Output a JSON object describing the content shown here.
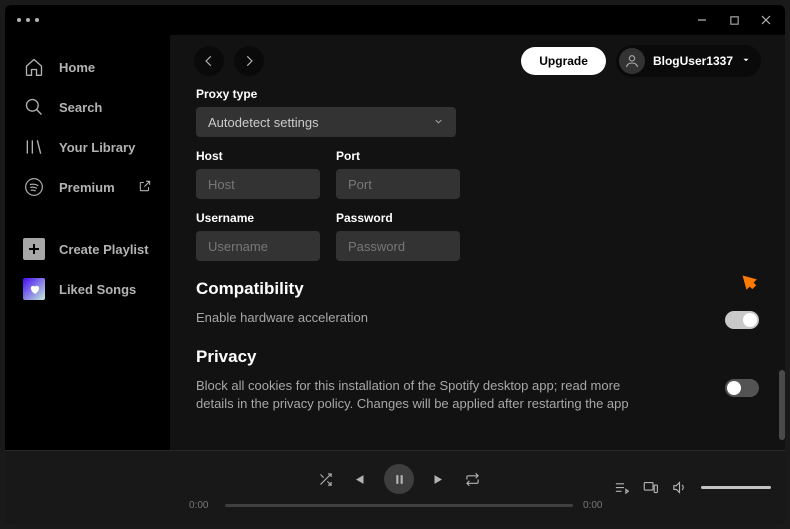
{
  "titlebar": {
    "minimize": "min",
    "maximize": "max",
    "close": "close"
  },
  "sidebar": {
    "home": "Home",
    "search": "Search",
    "library": "Your Library",
    "premium": "Premium",
    "create_playlist": "Create Playlist",
    "liked_songs": "Liked Songs"
  },
  "topbar": {
    "upgrade": "Upgrade",
    "username": "BlogUser1337"
  },
  "settings": {
    "proxy_type_label": "Proxy type",
    "proxy_select_value": "Autodetect settings",
    "host_label": "Host",
    "host_placeholder": "Host",
    "port_label": "Port",
    "port_placeholder": "Port",
    "username_label": "Username",
    "username_placeholder": "Username",
    "password_label": "Password",
    "password_placeholder": "Password",
    "compat_heading": "Compatibility",
    "hw_accel": "Enable hardware acceleration",
    "privacy_heading": "Privacy",
    "cookies_text": "Block all cookies for this installation of the Spotify desktop app; read more details in the privacy policy. Changes will be applied after restarting the app"
  },
  "player": {
    "time_current": "0:00",
    "time_total": "0:00"
  }
}
